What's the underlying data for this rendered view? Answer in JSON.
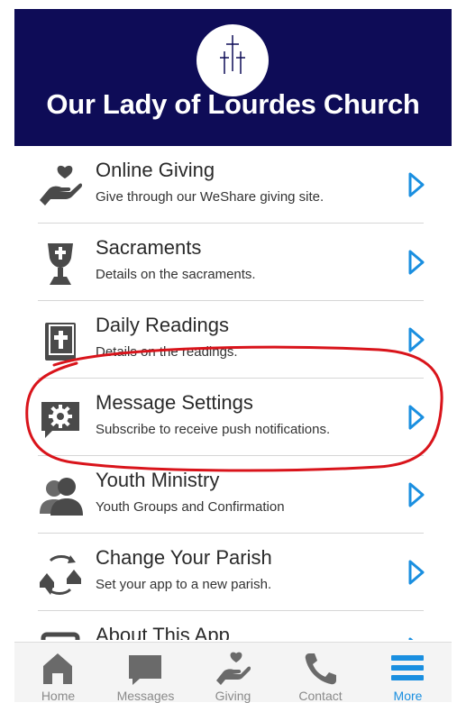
{
  "header": {
    "church_name": "Our Lady of Lourdes Church",
    "logo_icon": "three-crosses-icon",
    "background": "#0e0c57"
  },
  "menu": {
    "items": [
      {
        "title": "Online Giving",
        "subtitle": "Give through our WeShare giving site.",
        "icon": "hand-heart-icon"
      },
      {
        "title": "Sacraments",
        "subtitle": "Details on the sacraments.",
        "icon": "chalice-icon"
      },
      {
        "title": "Daily Readings",
        "subtitle": "Details on the readings.",
        "icon": "bible-icon"
      },
      {
        "title": "Message Settings",
        "subtitle": "Subscribe to receive push notifications.",
        "icon": "gear-chat-icon"
      },
      {
        "title": "Youth Ministry",
        "subtitle": "Youth Groups and Confirmation",
        "icon": "people-icon"
      },
      {
        "title": "Change Your Parish",
        "subtitle": "Set your app to a new parish.",
        "icon": "change-parish-icon"
      },
      {
        "title": "About This App",
        "subtitle": "",
        "icon": "question-icon"
      }
    ],
    "chevron_color": "#1a8fe0",
    "annotation_color": "#d9141b"
  },
  "tabbar": {
    "tabs": [
      {
        "label": "Home",
        "icon": "home-icon"
      },
      {
        "label": "Messages",
        "icon": "messages-icon"
      },
      {
        "label": "Giving",
        "icon": "giving-icon"
      },
      {
        "label": "Contact",
        "icon": "phone-icon"
      },
      {
        "label": "More",
        "icon": "hamburger-icon",
        "active": true
      }
    ],
    "active_color": "#1a8fe0"
  }
}
